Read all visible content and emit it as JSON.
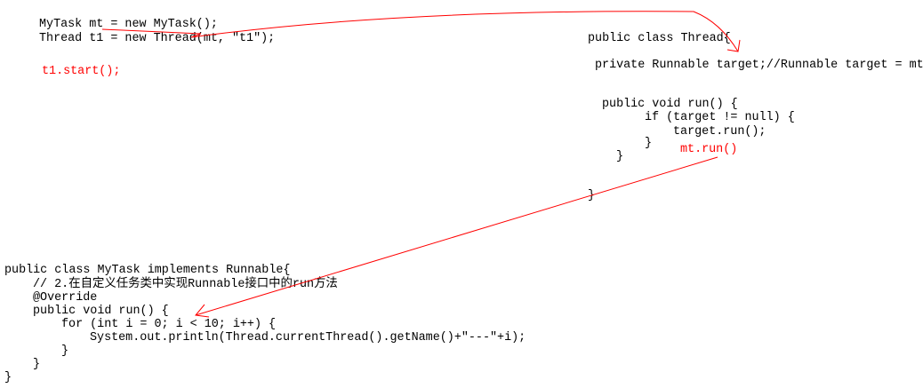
{
  "caller": {
    "line1": "MyTask mt = new MyTask();",
    "line2": "Thread t1 = new Thread(mt, \"t1\");",
    "start": "t1.start();"
  },
  "thread_class": {
    "decl": "public class Thread{",
    "field": "private Runnable target;//Runnable target = mt",
    "run_decl": "public void run() {",
    "if_line": "if (target != null) {",
    "call": "target.run();",
    "close_if": "}",
    "close_run": "}",
    "close_class": "}",
    "annotation": "mt.run()"
  },
  "task_class": {
    "decl": "public class MyTask implements Runnable{",
    "comment": "// 2.在自定义任务类中实现Runnable接口中的run方法",
    "override": "@Override",
    "run_decl": "public void run() {",
    "for_line": "for (int i = 0; i < 10; i++) {",
    "print": "System.out.println(Thread.currentThread().getName()+\"---\"+i);",
    "close_for": "}",
    "close_run": "}",
    "close_class": "}"
  },
  "colors": {
    "arrow": "#ff0000",
    "text": "#000000",
    "highlight": "#ff0000"
  }
}
